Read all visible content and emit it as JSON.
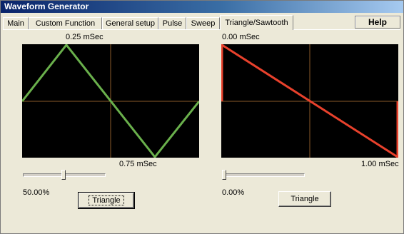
{
  "window": {
    "title": "Waveform Generator",
    "help_label": "Help"
  },
  "tabs": [
    {
      "label": "Main"
    },
    {
      "label": "Custom Function"
    },
    {
      "label": "General setup"
    },
    {
      "label": "Pulse"
    },
    {
      "label": "Sweep"
    },
    {
      "label": "Triangle/Sawtooth"
    }
  ],
  "active_tab": "Triangle/Sawtooth",
  "left_panel": {
    "top_label": "0.25 mSec",
    "bottom_label": "0.75 mSec",
    "slider_value": "50.00%",
    "slider_level": 0.5,
    "button_label": "Triangle",
    "trace_color": "#6ab04c"
  },
  "right_panel": {
    "top_label": "0.00 mSec",
    "bottom_label": "1.00 mSec",
    "slider_value": "0.00%",
    "slider_level": 0.0,
    "button_label": "Triangle",
    "trace_color": "#e8412c"
  }
}
